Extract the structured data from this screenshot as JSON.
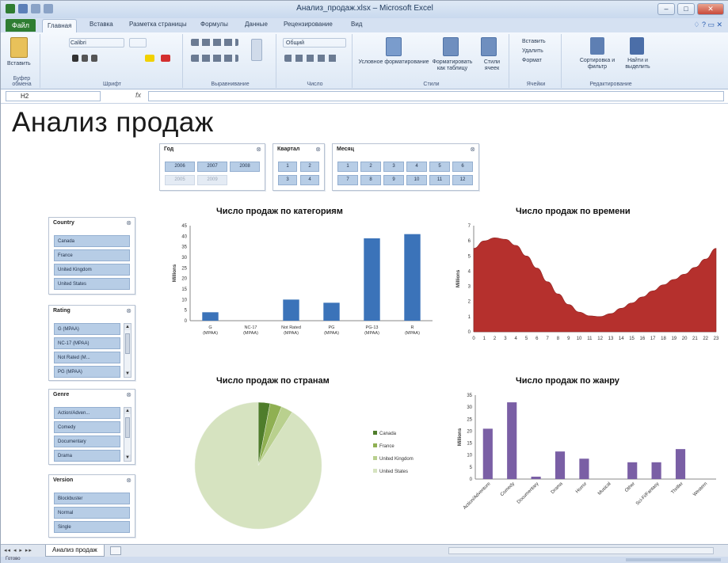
{
  "window": {
    "title": "Анализ_продаж.xlsx – Microsoft Excel",
    "minimize": "–",
    "maximize": "□",
    "close": "✕"
  },
  "ribbon": {
    "file_tab": "Файл",
    "tabs": [
      "Главная",
      "Вставка",
      "Разметка страницы",
      "Формулы",
      "Данные",
      "Рецензирование",
      "Вид"
    ],
    "help": "♢ ? ▭ ✕",
    "groups": {
      "clipboard": "Буфер обмена",
      "font": "Шрифт",
      "alignment": "Выравнивание",
      "number": "Число",
      "styles": "Стили",
      "cells": "Ячейки",
      "editing": "Редактирование"
    },
    "font_name": "Calibri",
    "number_format": "Общий",
    "buttons": {
      "paste": "Вставить",
      "conditional": "Условное форматирование",
      "as_table": "Форматировать как таблицу",
      "cell_styles": "Стили ячеек",
      "insert": "Вставить",
      "delete": "Удалить",
      "format": "Формат",
      "sort": "Сортировка и фильтр",
      "find": "Найти и выделить"
    }
  },
  "formula_bar": {
    "name_box": "H2",
    "fx": "fx"
  },
  "sheet": {
    "title": "Анализ продаж",
    "tab_name": "Анализ продаж",
    "tab_nav": "◂◂ ◂ ▸ ▸▸"
  },
  "slicers": {
    "year": {
      "title": "Год",
      "clear": "⊗",
      "items": [
        {
          "label": "2006",
          "on": true
        },
        {
          "label": "2007",
          "on": true
        },
        {
          "label": "2008",
          "on": true
        },
        {
          "label": "2005",
          "on": false
        },
        {
          "label": "2009",
          "on": false
        }
      ]
    },
    "quarter": {
      "title": "Квартал",
      "clear": "⊗",
      "items": [
        "1",
        "2",
        "3",
        "4"
      ]
    },
    "month": {
      "title": "Месяц",
      "clear": "⊗",
      "items": [
        "1",
        "2",
        "3",
        "4",
        "5",
        "6",
        "7",
        "8",
        "9",
        "10",
        "11",
        "12"
      ]
    },
    "country": {
      "title": "Country",
      "clear": "⊗",
      "items": [
        "Canada",
        "France",
        "United Kingdom",
        "United States"
      ]
    },
    "rating": {
      "title": "Rating",
      "clear": "⊗",
      "items": [
        "G (MPAA)",
        "NC-17 (MPAA)",
        "Not Rated (M...",
        "PG (MPAA)"
      ]
    },
    "genre": {
      "title": "Genre",
      "clear": "⊗",
      "items": [
        "Action/Adven...",
        "Comedy",
        "Documentary",
        "Drama"
      ]
    },
    "version": {
      "title": "Version",
      "clear": "⊗",
      "items": [
        "Blockbuster",
        "Normal",
        "Single"
      ]
    }
  },
  "chart_data": [
    {
      "type": "bar",
      "title": "Число продаж по категориям",
      "ylabel": "Millions",
      "categories": [
        "G (MPAA)",
        "NC-17 (MPAA)",
        "Not Rated (MPAA)",
        "PG (MPAA)",
        "PG-13 (MPAA)",
        "R (MPAA)"
      ],
      "values": [
        4,
        0,
        10,
        8.5,
        39,
        41
      ],
      "ylim": [
        0,
        45
      ],
      "yticks": [
        0,
        5,
        10,
        15,
        20,
        25,
        30,
        35,
        40,
        45
      ],
      "color": "#3b73b9"
    },
    {
      "type": "area",
      "title": "Число продаж по времени",
      "ylabel": "Millions",
      "x": [
        0,
        1,
        2,
        3,
        4,
        5,
        6,
        7,
        8,
        9,
        10,
        11,
        12,
        13,
        14,
        15,
        16,
        17,
        18,
        19,
        20,
        21,
        22,
        23
      ],
      "values": [
        5.5,
        6.0,
        6.2,
        6.1,
        5.7,
        5.0,
        4.2,
        3.3,
        2.5,
        1.8,
        1.3,
        1.05,
        1.0,
        1.2,
        1.55,
        1.9,
        2.3,
        2.7,
        3.1,
        3.45,
        3.8,
        4.25,
        4.8,
        5.5
      ],
      "ylim": [
        0,
        7
      ],
      "yticks": [
        0,
        1,
        2,
        3,
        4,
        5,
        6,
        7
      ],
      "color": "#b5302d"
    },
    {
      "type": "pie",
      "title": "Число продаж по странам",
      "categories": [
        "Canada",
        "France",
        "United Kingdom",
        "United States"
      ],
      "values": [
        3,
        3,
        3,
        91
      ],
      "colors": [
        "#4f7d2b",
        "#8fb052",
        "#b9d08e",
        "#d6e3c0"
      ],
      "legend": "right"
    },
    {
      "type": "bar",
      "title": "Число продаж по жанру",
      "ylabel": "Millions",
      "categories": [
        "Action/Adventure",
        "Comedy",
        "Documentary",
        "Drama",
        "Horror",
        "Musical",
        "Other",
        "Sci-Fi/Fantasy",
        "Thriller",
        "Western"
      ],
      "values": [
        21,
        32,
        1,
        11.5,
        8.5,
        0,
        7,
        7,
        12.5,
        0
      ],
      "ylim": [
        0,
        35
      ],
      "yticks": [
        0,
        5,
        10,
        15,
        20,
        25,
        30,
        35
      ],
      "color": "#7a5fa5"
    }
  ],
  "status": {
    "text": "Готово"
  }
}
